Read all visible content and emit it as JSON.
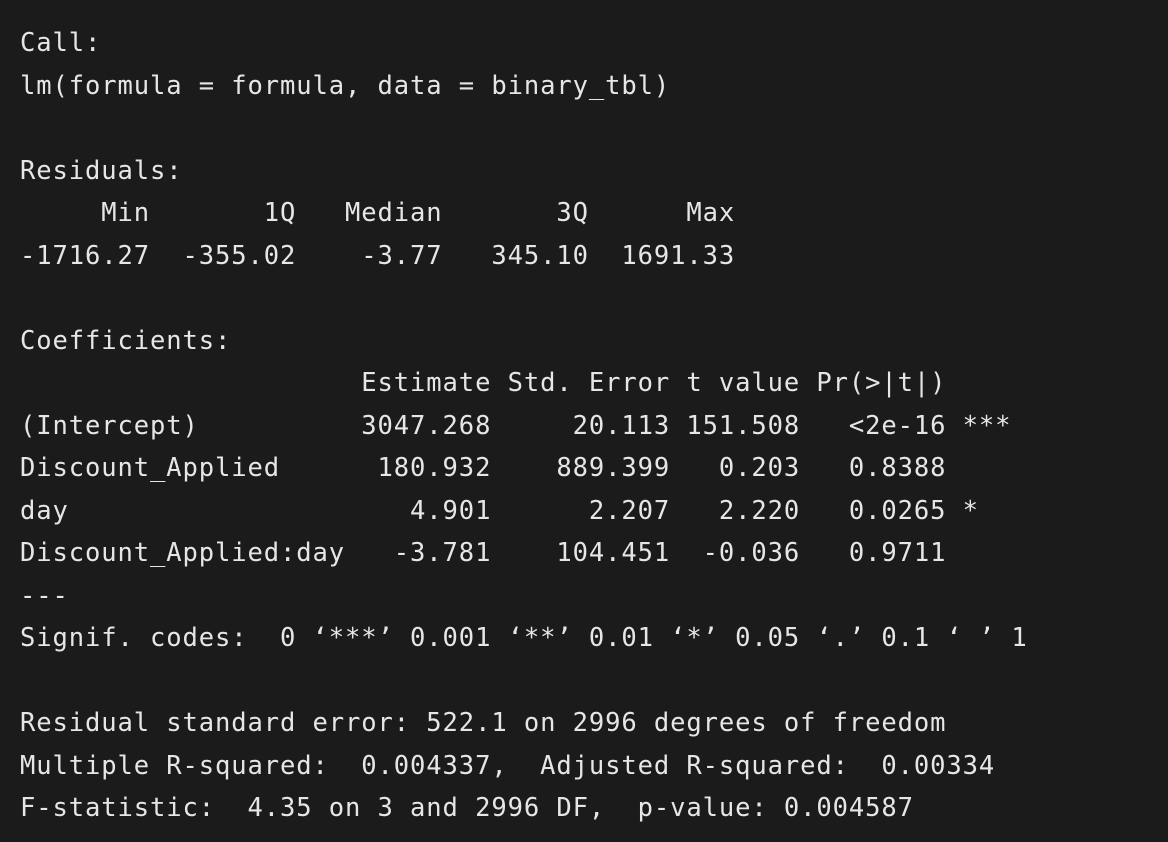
{
  "console": {
    "lines": [
      "Call:",
      "lm(formula = formula, data = binary_tbl)",
      "",
      "Residuals:",
      "     Min       1Q   Median       3Q      Max ",
      "-1716.27  -355.02    -3.77   345.10  1691.33 ",
      "",
      "Coefficients:",
      "                     Estimate Std. Error t value Pr(>|t|)    ",
      "(Intercept)          3047.268     20.113 151.508   <2e-16 ***",
      "Discount_Applied      180.932    889.399   0.203   0.8388    ",
      "day                     4.901      2.207   2.220   0.0265 *  ",
      "Discount_Applied:day   -3.781    104.451  -0.036   0.9711    ",
      "---",
      "Signif. codes:  0 ‘***’ 0.001 ‘**’ 0.01 ‘*’ 0.05 ‘.’ 0.1 ‘ ’ 1",
      "",
      "Residual standard error: 522.1 on 2996 degrees of freedom",
      "Multiple R-squared:  0.004337,  Adjusted R-squared:  0.00334 ",
      "F-statistic:  4.35 on 3 and 2996 DF,  p-value: 0.004587"
    ]
  }
}
